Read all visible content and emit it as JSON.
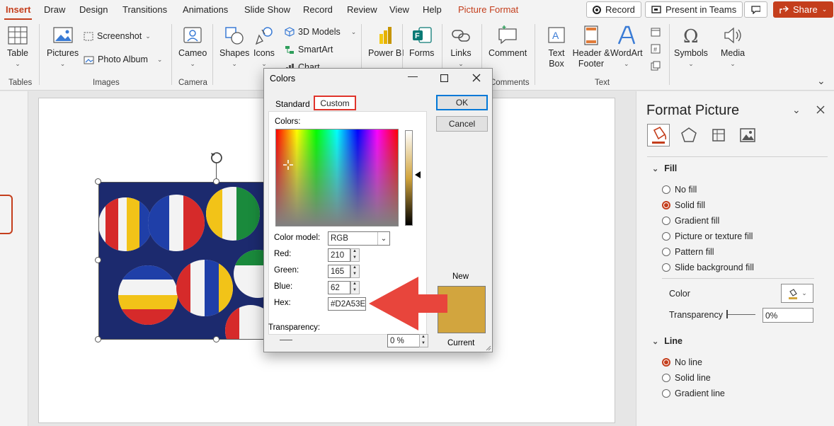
{
  "ribbon_tabs": [
    "Insert",
    "Draw",
    "Design",
    "Transitions",
    "Animations",
    "Slide Show",
    "Record",
    "Review",
    "View",
    "Help",
    "Picture Format"
  ],
  "top_buttons": {
    "record": "Record",
    "present": "Present in Teams",
    "share": "Share"
  },
  "ribbon": {
    "table": "Table",
    "pictures": "Pictures",
    "screenshot": "Screenshot",
    "photo_album": "Photo Album",
    "cameo": "Cameo",
    "shapes": "Shapes",
    "icons": "Icons",
    "models_3d": "3D Models",
    "smartart": "SmartArt",
    "chart": "Chart",
    "power_bi": "Power BI",
    "forms": "Forms",
    "links": "Links",
    "comment": "Comment",
    "text_box": "Text Box",
    "header_footer": "Header & Footer",
    "wordart": "WordArt",
    "symbols": "Symbols",
    "media": "Media",
    "groups": {
      "tables": "Tables",
      "images": "Images",
      "camera": "Camera",
      "comments": "Comments",
      "text": "Text"
    }
  },
  "format_pane": {
    "title": "Format Picture",
    "fill_header": "Fill",
    "fill_options": [
      {
        "label": "No fill",
        "selected": false
      },
      {
        "label": "Solid fill",
        "selected": true
      },
      {
        "label": "Gradient fill",
        "selected": false
      },
      {
        "label": "Picture or texture fill",
        "selected": false
      },
      {
        "label": "Pattern fill",
        "selected": false
      },
      {
        "label": "Slide background fill",
        "selected": false
      }
    ],
    "color_label": "Color",
    "transparency_label": "Transparency",
    "transparency_value": "0%",
    "line_header": "Line",
    "line_options": [
      {
        "label": "No line",
        "selected": true
      },
      {
        "label": "Solid line",
        "selected": false
      },
      {
        "label": "Gradient line",
        "selected": false
      }
    ]
  },
  "colors_dialog": {
    "title": "Colors",
    "tab_standard": "Standard",
    "tab_custom": "Custom",
    "ok": "OK",
    "cancel": "Cancel",
    "colors_label": "Colors:",
    "color_model_label": "Color model:",
    "color_model_value": "RGB",
    "red_label": "Red:",
    "red_value": "210",
    "green_label": "Green:",
    "green_value": "165",
    "blue_label": "Blue:",
    "blue_value": "62",
    "hex_label": "Hex:",
    "hex_value": "#D2A53E",
    "transparency_label": "Transparency:",
    "transparency_value": "0 %",
    "new_label": "New",
    "current_label": "Current",
    "swatch_color": "#D2A53E"
  },
  "colors": {
    "accent": "#c43e1c",
    "arrow": "#e8453c"
  }
}
